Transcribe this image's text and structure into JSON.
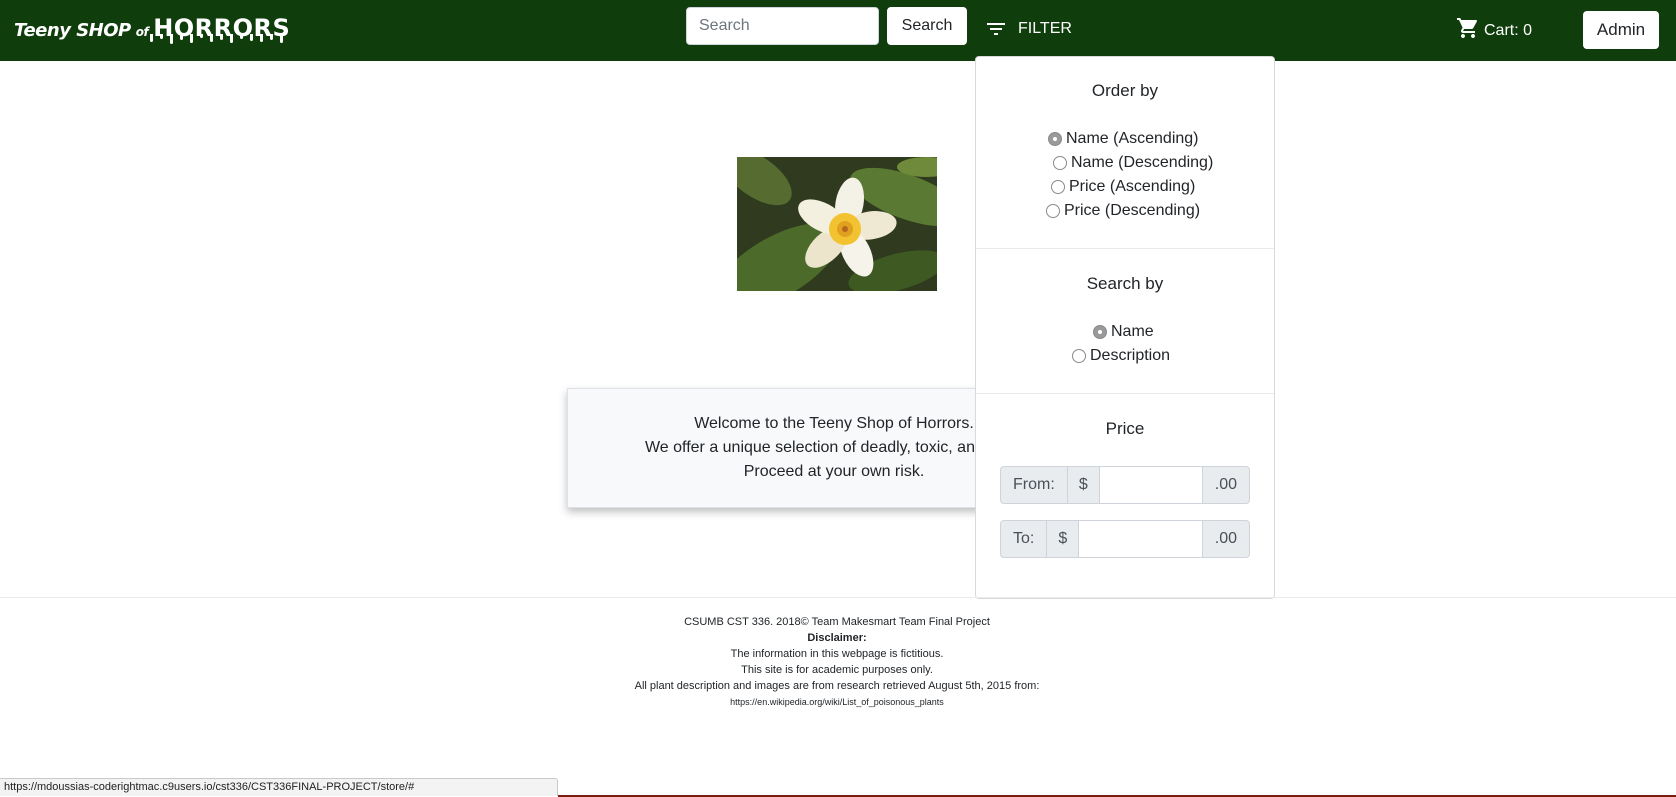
{
  "navbar": {
    "brand": {
      "part1": "Teeny SHOP",
      "part2": "of",
      "part3": "HORRORS"
    },
    "search": {
      "placeholder": "Search",
      "button_label": "Search"
    },
    "filter_label": "FILTER",
    "cart_label": "Cart: 0",
    "admin_label": "Admin",
    "background_color": "#0f3d0c"
  },
  "welcome": {
    "line1": "Welcome to the Teeny Shop of Horrors.",
    "line2": "We offer a unique selection of deadly, toxic, and carni",
    "line3": "Proceed at your own risk."
  },
  "filter_menu": {
    "order_by": {
      "title": "Order by",
      "options": [
        {
          "label": "Name (Ascending)",
          "checked": true
        },
        {
          "label": "Name (Descending)",
          "checked": false
        },
        {
          "label": "Price (Ascending)",
          "checked": false
        },
        {
          "label": "Price (Descending)",
          "checked": false
        }
      ]
    },
    "search_by": {
      "title": "Search by",
      "options": [
        {
          "label": "Name",
          "checked": true
        },
        {
          "label": "Description",
          "checked": false
        }
      ]
    },
    "price": {
      "title": "Price",
      "from": {
        "label": "From:",
        "currency": "$",
        "value": "",
        "suffix": ".00"
      },
      "to": {
        "label": "To:",
        "currency": "$",
        "value": "",
        "suffix": ".00"
      }
    }
  },
  "footer": {
    "line1": "CSUMB CST 336. 2018© Team Makesmart Team Final Project",
    "line2": "Disclaimer:",
    "line3": "The information in this webpage is fictitious.",
    "line4": "This site is for academic purposes only.",
    "line5": "All plant description and images are from research retrieved August 5th, 2015 from:",
    "line6": "https://en.wikipedia.org/wiki/List_of_poisonous_plants"
  },
  "status_bar": {
    "url": "https://mdoussias-coderightmac.c9users.io/cst336/CST336FINAL-PROJECT/store/#"
  }
}
